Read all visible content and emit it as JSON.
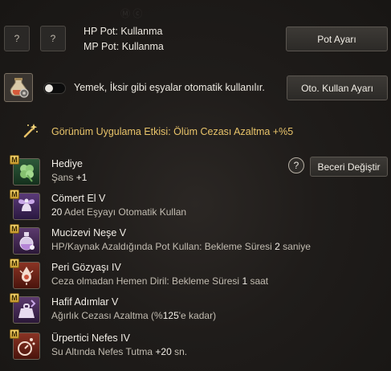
{
  "pot_slots": [
    {
      "label": "?"
    },
    {
      "label": "?"
    }
  ],
  "pot_status": {
    "hp": "HP Pot: Kullanma",
    "mp": "MP Pot: Kullanma"
  },
  "pot_settings_button": "Pot Ayarı",
  "auto_use": {
    "description": "Yemek, İksir gibi eşyalar otomatik kullanılır.",
    "button": "Oto. Kullan Ayarı",
    "enabled": false
  },
  "appearance_effect": "Görünüm Uygulama Etkisi: Ölüm Cezası Azaltma +%5",
  "help_label": "?",
  "change_skill_button": "Beceri Değiştir",
  "skills": [
    {
      "badge": "M",
      "name": "Hediye",
      "desc_text": "Şans ",
      "desc_num": "+1",
      "desc_suffix": "",
      "icon": "clover-icon"
    },
    {
      "badge": "M",
      "name": "Cömert El V",
      "desc_text": "",
      "desc_num": "20",
      "desc_suffix": " Adet Eşyayı Otomatik Kullan",
      "icon": "fairy-hand-icon"
    },
    {
      "badge": "M",
      "name": "Mucizevi Neşe V",
      "desc_text": "HP/Kaynak Azaldığında Pot Kullan: Bekleme Süresi ",
      "desc_num": "2",
      "desc_suffix": " saniye",
      "icon": "potion-icon"
    },
    {
      "badge": "M",
      "name": "Peri Gözyaşı IV",
      "desc_text": "Ceza olmadan Hemen Diril: Bekleme Süresi ",
      "desc_num": "1",
      "desc_suffix": " saat",
      "icon": "tear-icon"
    },
    {
      "badge": "M",
      "name": "Hafif Adımlar V",
      "desc_text": "Ağırlık Cezası Azaltma (%",
      "desc_num": "125",
      "desc_suffix": "'e kadar)",
      "icon": "weight-icon"
    },
    {
      "badge": "M",
      "name": "Ürpertici Nefes IV",
      "desc_text": "Su Altında Nefes Tutma ",
      "desc_num": "+20",
      "desc_suffix": " sn.",
      "icon": "breath-icon"
    }
  ],
  "colors": {
    "effect_text": "#e9c46a",
    "badge": "#e3bc4e"
  }
}
